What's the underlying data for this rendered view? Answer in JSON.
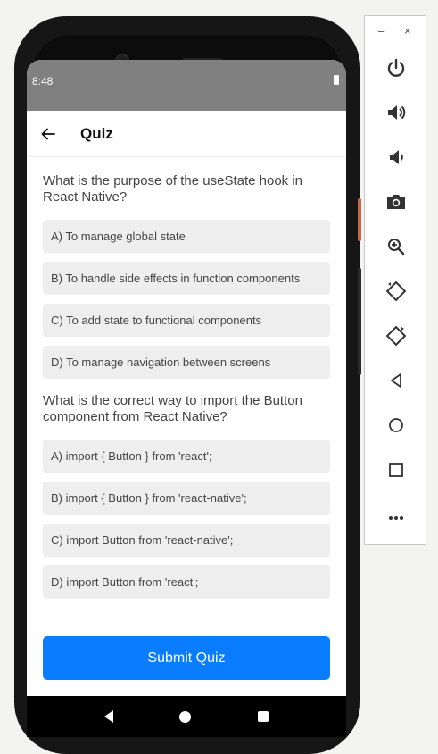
{
  "status": {
    "time": "8:48"
  },
  "appbar": {
    "title": "Quiz",
    "back_icon": "arrow-left-icon"
  },
  "questions": [
    {
      "text": "What is the purpose of the useState hook in React Native?",
      "options": [
        "A) To manage global state",
        "B) To handle side effects in function components",
        "C) To add state to functional components",
        "D) To manage navigation between screens"
      ]
    },
    {
      "text": "What is the correct way to import the Button component from React Native?",
      "options": [
        "A) import { Button } from 'react';",
        "B) import { Button } from 'react-native';",
        "C) import Button from 'react-native';",
        "D) import Button from 'react';"
      ]
    }
  ],
  "submit_label": "Submit Quiz",
  "colors": {
    "primary": "#0a7cff",
    "statusbar": "#808080",
    "option_bg": "#eeeeee"
  },
  "toolbar": {
    "minimize_label": "–",
    "close_label": "×",
    "items": [
      "power-icon",
      "volume-up-icon",
      "volume-down-icon",
      "camera-icon",
      "zoom-in-icon",
      "rotate-left-icon",
      "rotate-right-icon",
      "back-icon",
      "home-icon",
      "overview-icon",
      "more-icon"
    ]
  }
}
